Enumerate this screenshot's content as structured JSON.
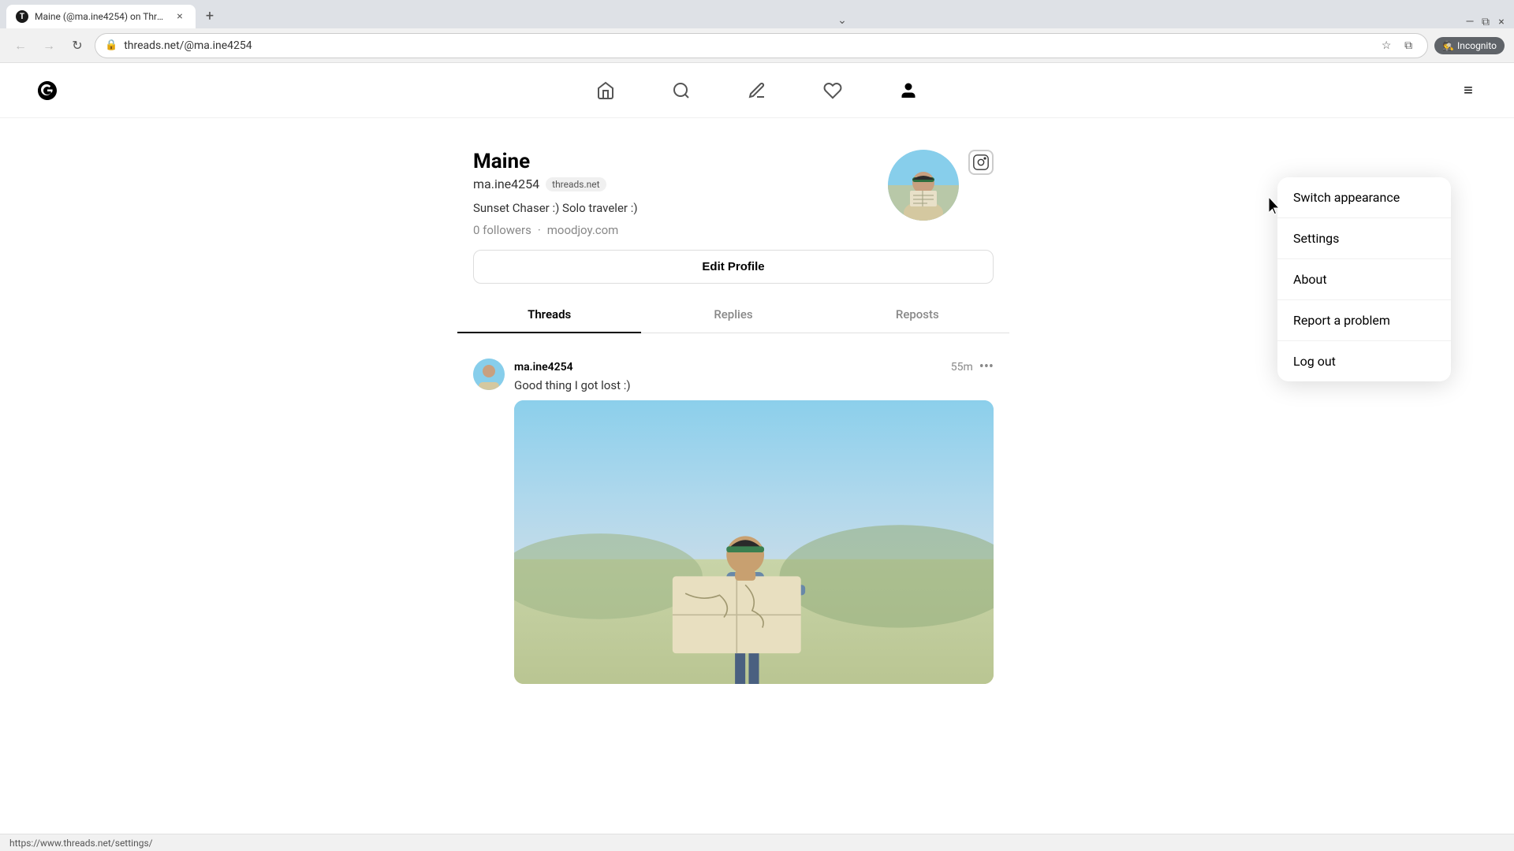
{
  "browser": {
    "tab": {
      "favicon": "T",
      "title": "Maine (@ma.ine4254) on Threa…",
      "close_label": "×"
    },
    "new_tab_label": "+",
    "tab_dropdown_label": "⌄",
    "toolbar": {
      "back_label": "←",
      "forward_label": "→",
      "reload_label": "↻",
      "address": "threads.net/@ma.ine4254",
      "bookmark_label": "☆",
      "tab_manager_label": "⧉",
      "incognito_label": "Incognito",
      "minimize_label": "—",
      "maximize_label": "⧉",
      "close_label": "×"
    }
  },
  "app": {
    "logo": "@",
    "nav": {
      "home_label": "⌂",
      "search_label": "⌕",
      "compose_label": "✎",
      "activity_label": "♡",
      "profile_label": "👤"
    },
    "menu_label": "≡"
  },
  "profile": {
    "name": "Maine",
    "username": "ma.ine4254",
    "badge": "threads.net",
    "bio": "Sunset Chaser :) Solo traveler :)",
    "followers": "0 followers",
    "dot": "·",
    "website": "moodjoy.com",
    "edit_profile_label": "Edit Profile",
    "instagram_icon": "⊡",
    "tabs": [
      {
        "label": "Threads",
        "active": true
      },
      {
        "label": "Replies",
        "active": false
      },
      {
        "label": "Reposts",
        "active": false
      }
    ]
  },
  "post": {
    "username": "ma.ine4254",
    "time": "55m",
    "more_label": "•••",
    "text": "Good thing I got lost :)"
  },
  "dropdown": {
    "items": [
      {
        "label": "Switch appearance"
      },
      {
        "label": "Settings"
      },
      {
        "label": "About"
      },
      {
        "label": "Report a problem"
      },
      {
        "label": "Log out"
      }
    ]
  },
  "status_bar": {
    "url": "https://www.threads.net/settings/"
  }
}
